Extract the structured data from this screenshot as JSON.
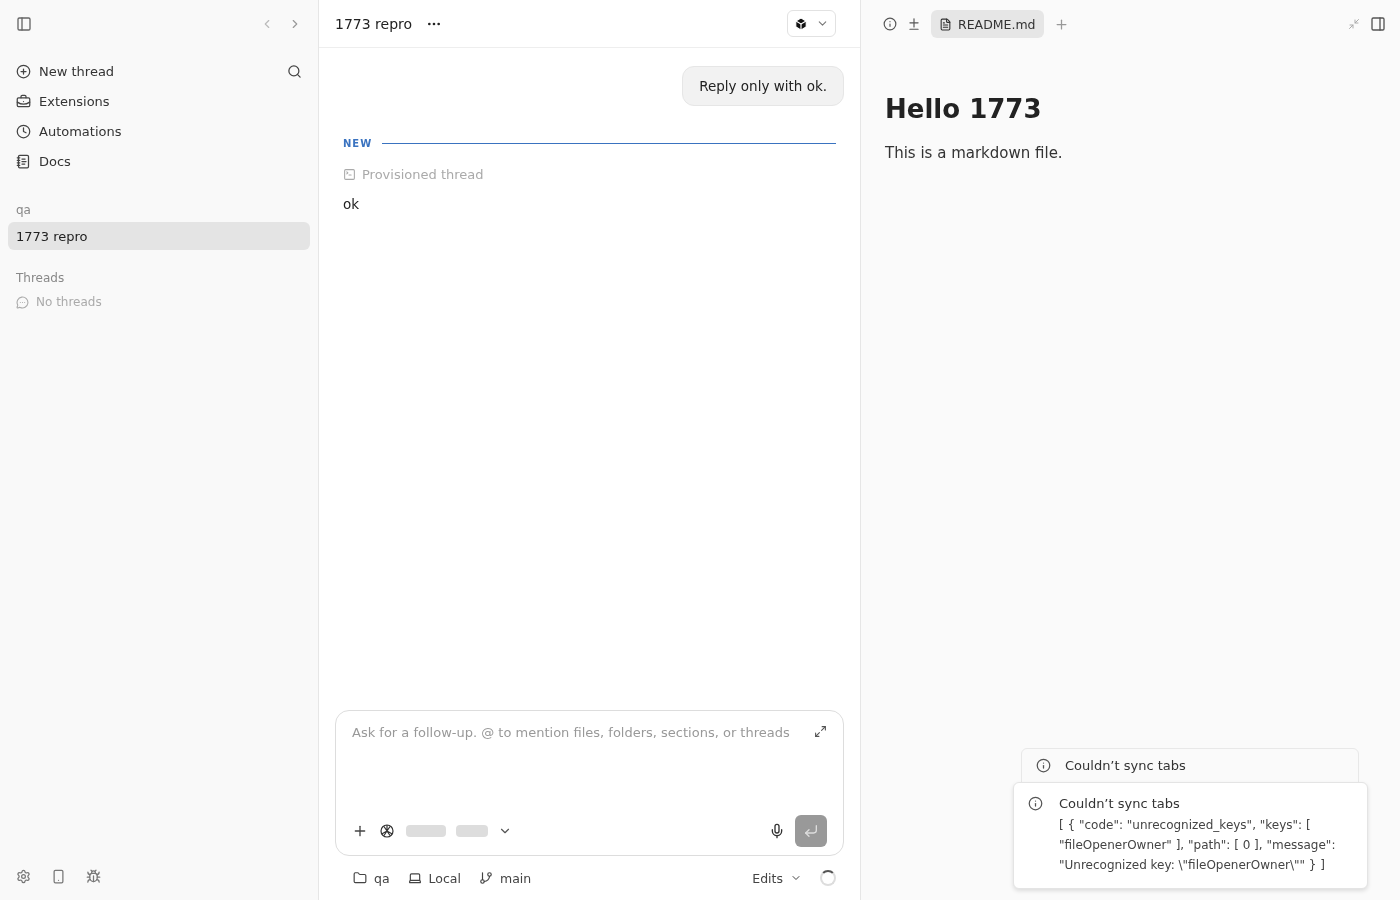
{
  "sidebar": {
    "nav": [
      {
        "label": "New thread"
      },
      {
        "label": "Extensions"
      },
      {
        "label": "Automations"
      },
      {
        "label": "Docs"
      }
    ],
    "project": "qa",
    "project_threads": [
      {
        "label": "1773 repro",
        "selected": true
      }
    ],
    "threads_heading": "Threads",
    "threads_empty": "No threads"
  },
  "chat": {
    "title": "1773 repro",
    "user_message": "Reply only with ok.",
    "divider": "NEW",
    "status": "Provisioned thread",
    "reply": "ok",
    "composer": {
      "placeholder": "Ask for a follow-up. @ to mention files, folders, sections, or threads"
    },
    "footer": [
      {
        "label": "qa"
      },
      {
        "label": "Local"
      },
      {
        "label": "main"
      }
    ],
    "edits": "Edits"
  },
  "preview": {
    "tabs": [
      {
        "label": "README.md",
        "selected": true
      }
    ],
    "heading": "Hello 1773",
    "paragraph": "This is a markdown file."
  },
  "toasts": [
    {
      "title": "Couldn’t sync tabs"
    },
    {
      "title": "Couldn’t sync tabs",
      "body": "[ { \"code\": \"unrecognized_keys\", \"keys\": [ \"fileOpenerOwner\" ], \"path\": [ 0 ], \"message\": \"Unrecognized key: \\\"fileOpenerOwner\\\"\" } ]"
    }
  ]
}
